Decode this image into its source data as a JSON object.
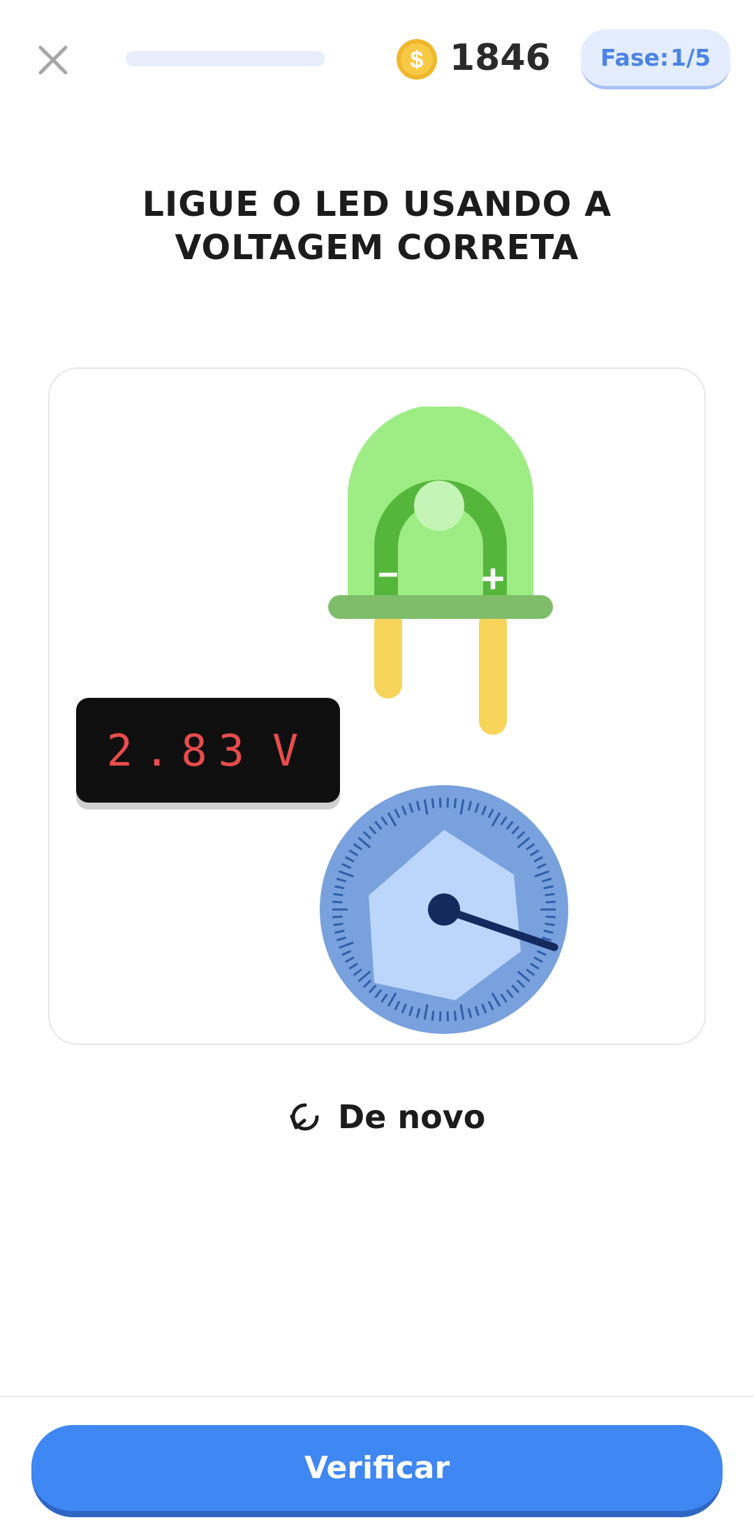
{
  "header": {
    "close_icon": "close-icon",
    "progress": 0,
    "coin_icon": "coin-icon",
    "coins": "1846",
    "phase_label": "Fase:",
    "phase_value": "1/5"
  },
  "title": "LIGUE O LED USANDO A VOLTAGEM CORRETA",
  "circuit": {
    "led_color": "#9ded84",
    "led_minus_label": "−",
    "led_plus_label": "+",
    "voltage_value": "2.83",
    "voltage_unit": "V",
    "knob_icon": "voltage-knob"
  },
  "actions": {
    "retry_icon": "refresh-icon",
    "retry_label": "De novo",
    "verify_label": "Verificar"
  },
  "colors": {
    "accent": "#3f87f2",
    "display_text": "#e84c4c"
  }
}
